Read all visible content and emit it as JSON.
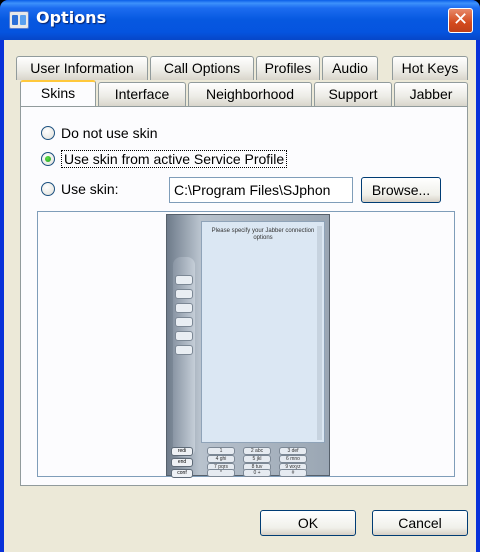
{
  "window": {
    "title": "Options",
    "close_glyph": "✕"
  },
  "tabs": {
    "back_row": [
      "User Information",
      "Call Options",
      "Profiles",
      "Audio",
      "Hot Keys"
    ],
    "front_row": [
      "Skins",
      "Interface",
      "Neighborhood",
      "Support",
      "Jabber"
    ],
    "active": "Skins"
  },
  "skins": {
    "option_none": "Do not use skin",
    "option_profile": "Use skin from active Service Profile",
    "option_custom": "Use skin:",
    "selected": "Use skin from active Service Profile",
    "path_value": "C:\\Program Files\\SJphon",
    "browse_label": "Browse..."
  },
  "preview": {
    "message": "Please specify your Jabber connection options",
    "side_keys": [
      "redi",
      "end",
      "conf"
    ],
    "keypad": [
      "1",
      "2 abc",
      "3 def",
      "4 ghi",
      "5 jkl",
      "6 mno",
      "7 pqrs",
      "8 tuv",
      "9 wxyz",
      "*",
      "0 +",
      "#"
    ]
  },
  "footer": {
    "ok_label": "OK",
    "cancel_label": "Cancel"
  },
  "colors": {
    "title_bar": "#0658e0",
    "client_bg": "#ece9d8",
    "active_tab_accent": "#ffc83c",
    "radio_check": "#21a121"
  }
}
